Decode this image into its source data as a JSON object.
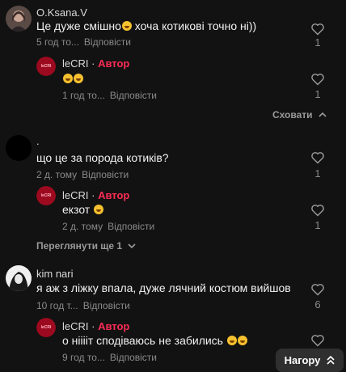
{
  "comments": [
    {
      "user": "O.Ksana.V",
      "text": "Це дуже смішно",
      "text_after_emoji": " хоча котикові точно ні))",
      "time": "5 год то...",
      "reply_label": "Відповісти",
      "likes": "1",
      "replies": [
        {
          "user": "leCRI",
          "separator": " · ",
          "badge": "Автор",
          "text": "",
          "time": "1 год то...",
          "reply_label": "Відповісти",
          "likes": "1"
        }
      ],
      "toggle_label": "Сховати"
    },
    {
      "user": ".",
      "text": "що це за порода котиків?",
      "time": "2 д. тому",
      "reply_label": "Відповісти",
      "likes": "1",
      "replies": [
        {
          "user": "leCRI",
          "separator": " · ",
          "badge": "Автор",
          "text": "екзот",
          "time": "2 д. тому",
          "reply_label": "Відповісти",
          "likes": "1"
        }
      ],
      "toggle_label": "Переглянути ще 1"
    },
    {
      "user": "kim nari",
      "text": "я аж з ліжку впала, дуже лячний костюм вийшов",
      "time": "10 год т...",
      "reply_label": "Відповісти",
      "likes": "6",
      "replies": [
        {
          "user": "leCRI",
          "separator": " · ",
          "badge": "Автор",
          "text": "о нііііт сподіваюсь не забились",
          "time": "9 год то...",
          "reply_label": "Відповісти",
          "likes": ""
        }
      ]
    }
  ],
  "scroll_top_label": "Нагору",
  "channel_logo_text": "leCRI",
  "colors": {
    "background": "#121212",
    "author": "#fe2c55",
    "meta": "#8a8a8a",
    "logo": "#9c0a1f"
  },
  "icons": {
    "like": "heart-outline-icon",
    "expand": "chevron-down-icon",
    "collapse": "chevron-up-icon",
    "top": "double-chevron-up-icon"
  }
}
